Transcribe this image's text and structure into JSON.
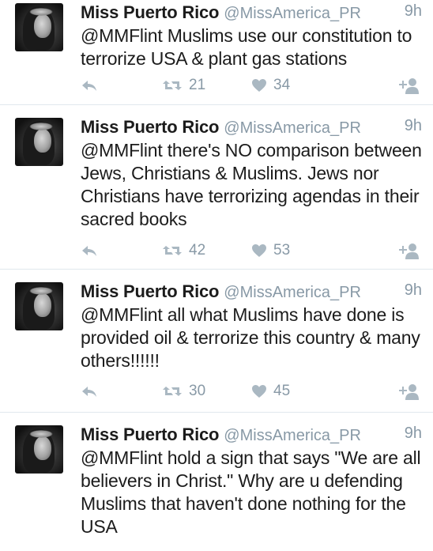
{
  "colors": {
    "name": "#1c1c1c",
    "muted": "#8899a6",
    "divider": "#e1e8ed",
    "icon": "#aab8c2"
  },
  "tweets": [
    {
      "name": "Miss Puerto Rico",
      "handle": "@MissAmerica_PR",
      "time": "9h",
      "text": "@MMFlint Muslims use our constitution to terrorize USA & plant gas stations",
      "retweets": "21",
      "likes": "34"
    },
    {
      "name": "Miss Puerto Rico",
      "handle": "@MissAmerica_PR",
      "time": "9h",
      "text": "@MMFlint there's NO comparison between Jews, Christians & Muslims. Jews nor Christians have terrorizing agendas in their sacred books",
      "retweets": "42",
      "likes": "53"
    },
    {
      "name": "Miss Puerto Rico",
      "handle": "@MissAmerica_PR",
      "time": "9h",
      "text": "@MMFlint all what Muslims have done is provided oil & terrorize this country & many others!!!!!!",
      "retweets": "30",
      "likes": "45"
    },
    {
      "name": "Miss Puerto Rico",
      "handle": "@MissAmerica_PR",
      "time": "9h",
      "text": "@MMFlint hold a sign that says \"We are all believers in Christ.\" Why are u defending Muslims that haven't done nothing for the USA",
      "retweets": "",
      "likes": ""
    }
  ]
}
